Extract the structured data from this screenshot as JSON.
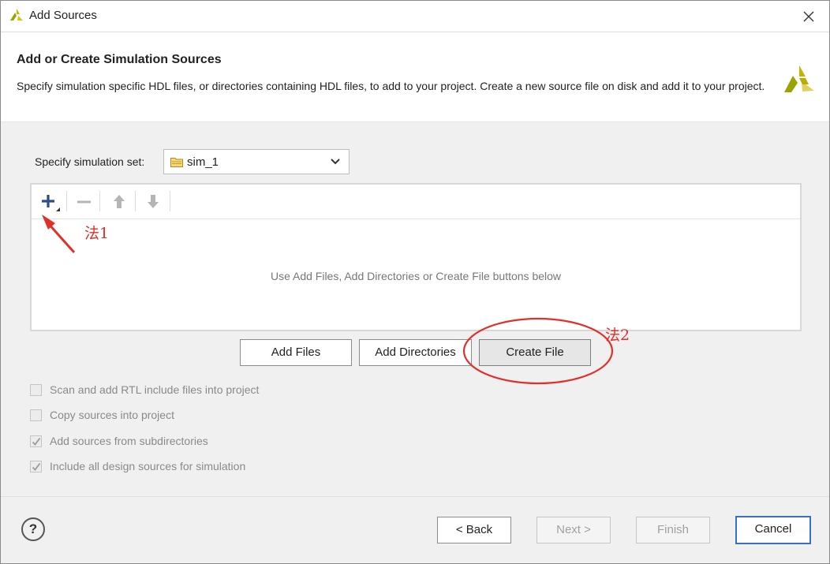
{
  "window": {
    "title": "Add Sources"
  },
  "header": {
    "title": "Add or Create Simulation Sources",
    "description": "Specify simulation specific HDL files, or directories containing HDL files, to add to your project. Create a new source file on disk and add it to your project."
  },
  "simulation_set": {
    "label": "Specify simulation set:",
    "value": "sim_1"
  },
  "toolbar": {
    "icons": [
      "add-icon",
      "remove-icon",
      "move-up-icon",
      "move-down-icon"
    ]
  },
  "files_panel": {
    "empty_message": "Use Add Files, Add Directories or Create File buttons below"
  },
  "action_buttons": {
    "add_files": "Add Files",
    "add_directories": "Add Directories",
    "create_file": "Create File"
  },
  "options": [
    {
      "label": "Scan and add RTL include files into project",
      "checked": false
    },
    {
      "label": "Copy sources into project",
      "checked": false
    },
    {
      "label": "Add sources from subdirectories",
      "checked": true
    },
    {
      "label": "Include all design sources for simulation",
      "checked": true
    }
  ],
  "footer": {
    "help": "?",
    "back": "< Back",
    "next": "Next >",
    "finish": "Finish",
    "cancel": "Cancel"
  },
  "annotations": {
    "method1": "法1",
    "method2": "法2",
    "color": "#e0302a"
  },
  "colors": {
    "brand_yellow": "#c8b400",
    "primary_border": "#3a6fc0",
    "toolbar_blue": "#2a4d8f"
  }
}
